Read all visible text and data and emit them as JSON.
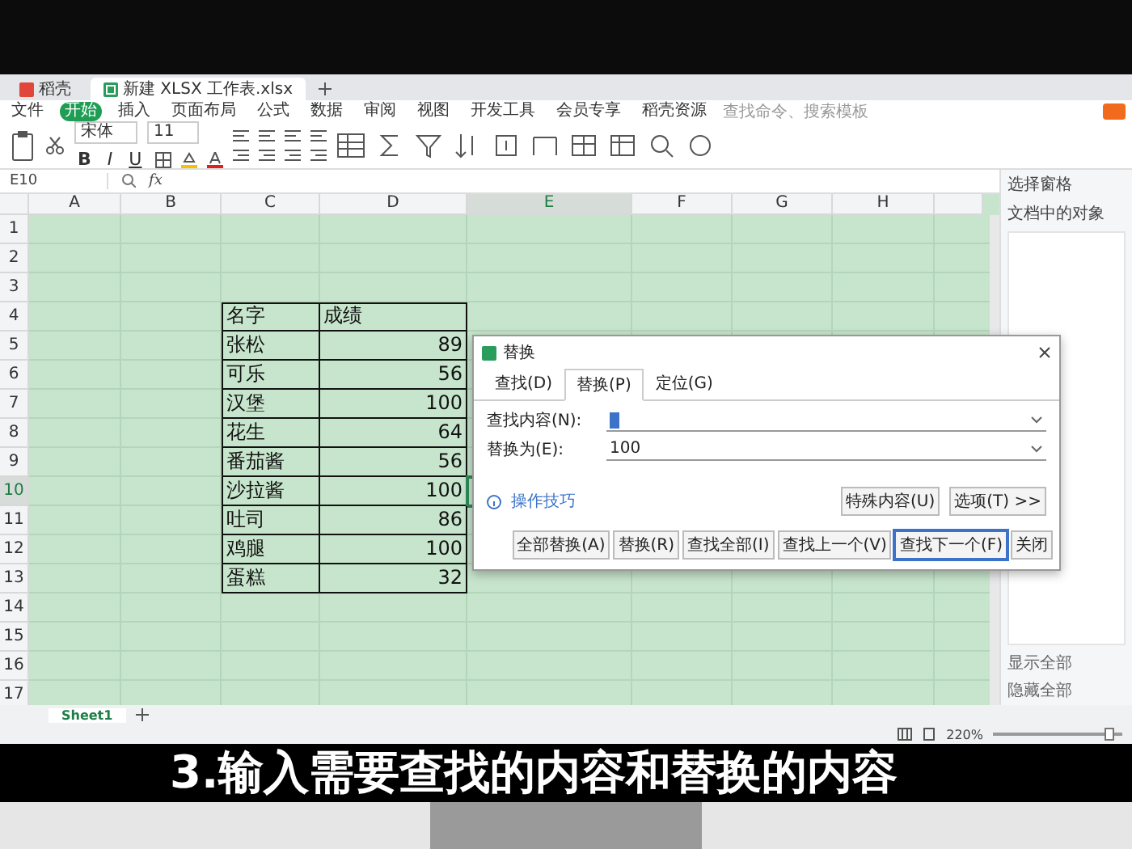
{
  "top_tabs": [
    {
      "label": "稻壳",
      "selected": false
    },
    {
      "label": "新建 XLSX 工作表.xlsx",
      "selected": true
    }
  ],
  "menu": [
    {
      "label": "文件",
      "selected": false
    },
    {
      "label": "开始",
      "selected": true
    },
    {
      "label": "插入",
      "selected": false
    },
    {
      "label": "页面布局",
      "selected": false
    },
    {
      "label": "公式",
      "selected": false
    },
    {
      "label": "数据",
      "selected": false
    },
    {
      "label": "审阅",
      "selected": false
    },
    {
      "label": "视图",
      "selected": false
    },
    {
      "label": "开发工具",
      "selected": false
    },
    {
      "label": "会员专享",
      "selected": false
    },
    {
      "label": "稻壳资源",
      "selected": false
    }
  ],
  "search": {
    "placeholder": "查找命令、搜索模板"
  },
  "ribbon": {
    "font": "宋体",
    "size": "11",
    "format_buttons": [
      "B",
      "I",
      "U"
    ]
  },
  "formula_bar": {
    "cell_ref": "E10",
    "fx": "fx"
  },
  "sheet": {
    "columns": [
      {
        "label": "A",
        "selected": false
      },
      {
        "label": "B",
        "selected": false
      },
      {
        "label": "C",
        "selected": false
      },
      {
        "label": "D",
        "selected": false
      },
      {
        "label": "E",
        "selected": true
      },
      {
        "label": "F",
        "selected": false
      },
      {
        "label": "G",
        "selected": false
      },
      {
        "label": "H",
        "selected": false
      }
    ],
    "rows": [
      {
        "label": "1",
        "selected": false
      },
      {
        "label": "2",
        "selected": false
      },
      {
        "label": "3",
        "selected": false
      },
      {
        "label": "4",
        "selected": false
      },
      {
        "label": "5",
        "selected": false
      },
      {
        "label": "6",
        "selected": false
      },
      {
        "label": "7",
        "selected": false
      },
      {
        "label": "8",
        "selected": false
      },
      {
        "label": "9",
        "selected": false
      },
      {
        "label": "10",
        "selected": true
      },
      {
        "label": "11",
        "selected": false
      },
      {
        "label": "12",
        "selected": false
      },
      {
        "label": "13",
        "selected": false
      },
      {
        "label": "14",
        "selected": false
      },
      {
        "label": "15",
        "selected": false
      },
      {
        "label": "16",
        "selected": false
      },
      {
        "label": "17",
        "selected": false
      }
    ],
    "table": {
      "header": [
        "名字",
        "成绩"
      ],
      "rows": [
        [
          "张松",
          "89"
        ],
        [
          "可乐",
          "56"
        ],
        [
          "汉堡",
          "100"
        ],
        [
          "花生",
          "64"
        ],
        [
          "番茄酱",
          "56"
        ],
        [
          "沙拉酱",
          "100"
        ],
        [
          "吐司",
          "86"
        ],
        [
          "鸡腿",
          "100"
        ],
        [
          "蛋糕",
          "32"
        ]
      ]
    }
  },
  "dialog": {
    "title": "替换",
    "tabs": [
      {
        "label": "查找(D)",
        "selected": false
      },
      {
        "label": "替换(P)",
        "selected": true
      },
      {
        "label": "定位(G)",
        "selected": false
      }
    ],
    "fields": [
      {
        "label": "查找内容(N):"
      },
      {
        "label": "替换为(E):",
        "value": "100"
      }
    ],
    "option_buttons": [
      "特殊内容(U)",
      "选项(T) >>"
    ],
    "tips_link": "操作技巧",
    "buttons": [
      {
        "label": "全部替换(A)",
        "focused": false
      },
      {
        "label": "替换(R)",
        "focused": false
      },
      {
        "label": "查找全部(I)",
        "focused": false
      },
      {
        "label": "查找上一个(V)",
        "focused": false
      },
      {
        "label": "查找下一个(F)",
        "focused": true
      },
      {
        "label": "关闭",
        "focused": false
      }
    ]
  },
  "side_panel": {
    "title": "选择窗格",
    "subtitle": "文档中的对象",
    "buttons": [
      "显示全部",
      "隐藏全部"
    ]
  },
  "sheet_tabs": [
    {
      "label": "Sheet1",
      "selected": true
    }
  ],
  "status_bar": {
    "zoom": "220%",
    "level": 0.9
  },
  "caption": "3.输入需要查找的内容和替换的内容"
}
